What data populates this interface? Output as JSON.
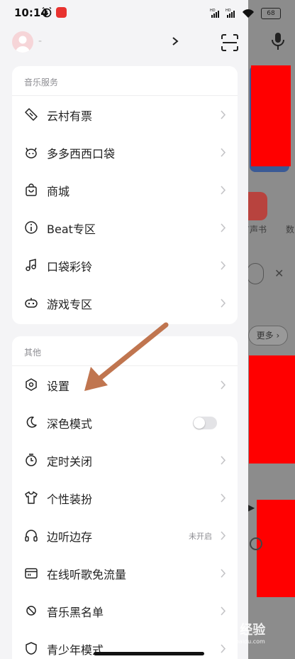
{
  "status_bar": {
    "time": "10:14",
    "battery": "68"
  },
  "profile": {
    "username": "-"
  },
  "background": {
    "label_books": "有声书",
    "label_digits": "数",
    "more_button": "更多"
  },
  "sections": [
    {
      "title": "音乐服务",
      "items": [
        {
          "label": "云村有票",
          "icon": "ticket-icon"
        },
        {
          "label": "多多西西口袋",
          "icon": "creature-icon"
        },
        {
          "label": "商城",
          "icon": "shopping-bag-icon"
        },
        {
          "label": "Beat专区",
          "icon": "info-circle-icon"
        },
        {
          "label": "口袋彩铃",
          "icon": "music-note-icon"
        },
        {
          "label": "游戏专区",
          "icon": "gamepad-icon"
        }
      ]
    },
    {
      "title": "其他",
      "items": [
        {
          "label": "设置",
          "icon": "settings-hexagon-icon"
        },
        {
          "label": "深色模式",
          "icon": "moon-icon",
          "toggle": false
        },
        {
          "label": "定时关闭",
          "icon": "timer-icon"
        },
        {
          "label": "个性装扮",
          "icon": "tshirt-icon"
        },
        {
          "label": "边听边存",
          "icon": "headphones-icon",
          "status": "未开启"
        },
        {
          "label": "在线听歌免流量",
          "icon": "sim-card-icon"
        },
        {
          "label": "音乐黑名单",
          "icon": "block-icon"
        },
        {
          "label": "青少年模式",
          "icon": "shield-icon"
        }
      ]
    }
  ],
  "watermark": {
    "text": "Bai 经验",
    "sub": "jingyan.baidu.com"
  },
  "colors": {
    "accent_red": "#e8322f",
    "annotation_arrow": "#c0754f",
    "redaction": "#ff0000"
  }
}
